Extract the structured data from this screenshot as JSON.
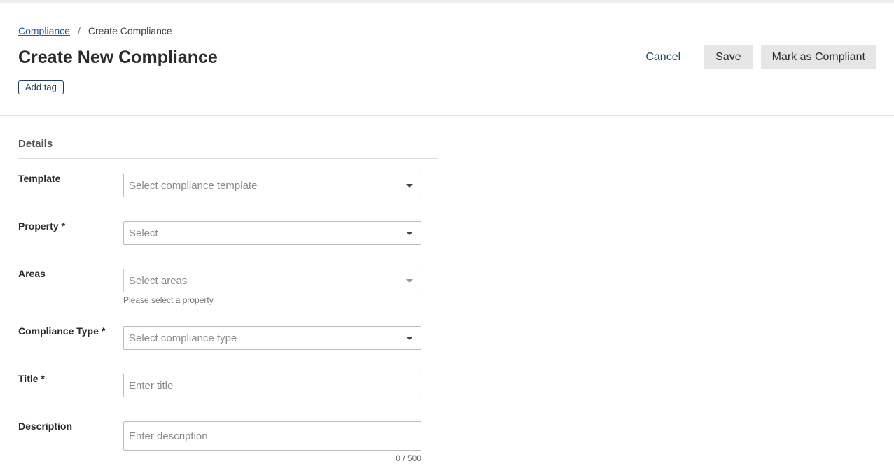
{
  "breadcrumb": {
    "parent": "Compliance",
    "separator": "/",
    "current": "Create Compliance"
  },
  "page": {
    "title": "Create New Compliance",
    "add_tag": "Add tag"
  },
  "actions": {
    "cancel": "Cancel",
    "save": "Save",
    "mark_compliant": "Mark as Compliant"
  },
  "details": {
    "section_title": "Details",
    "template": {
      "label": "Template",
      "placeholder": "Select compliance template"
    },
    "property": {
      "label": "Property *",
      "placeholder": "Select"
    },
    "areas": {
      "label": "Areas",
      "placeholder": "Select areas",
      "helper": "Please select a property"
    },
    "compliance_type": {
      "label": "Compliance Type *",
      "placeholder": "Select compliance type"
    },
    "title": {
      "label": "Title *",
      "placeholder": "Enter title",
      "value": ""
    },
    "description": {
      "label": "Description",
      "placeholder": "Enter description",
      "value": "",
      "counter": "0 / 500"
    }
  },
  "icons": {
    "dropdown": "chevron-down-icon"
  },
  "colors": {
    "link": "#1a5fa8",
    "button_gray": "#e6e6e6",
    "cancel_text": "#1f4e6b"
  }
}
